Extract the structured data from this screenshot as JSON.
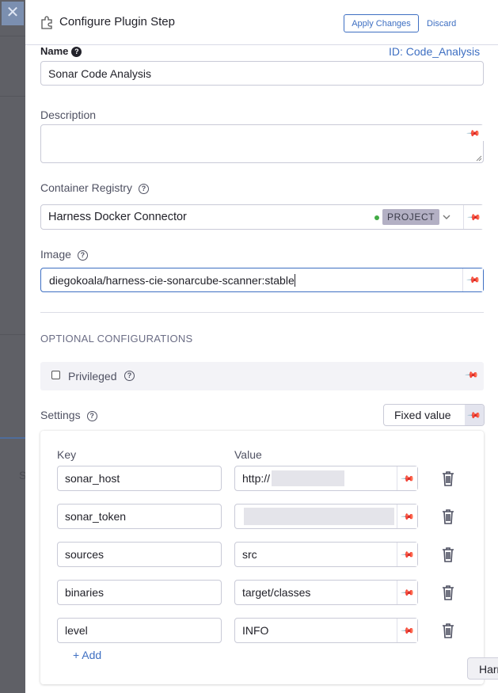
{
  "header": {
    "title": "Configure Plugin Step",
    "apply_label": "Apply Changes",
    "discard_label": "Discard"
  },
  "name_field": {
    "label": "Name",
    "value": "Sonar Code Analysis",
    "id_prefix": "ID: ",
    "id_value": "Code_Analysis"
  },
  "description": {
    "label": "Description",
    "value": ""
  },
  "registry": {
    "label": "Container Registry",
    "value": "Harness Docker Connector",
    "badge": "PROJECT",
    "status_color": "#42ab45"
  },
  "image": {
    "label": "Image",
    "value": "diegokoala/harness-cie-sonarcube-scanner:stable"
  },
  "optional": {
    "heading": "OPTIONAL CONFIGURATIONS",
    "privileged_label": "Privileged"
  },
  "settings": {
    "label": "Settings",
    "mode_label": "Fixed value",
    "key_header": "Key",
    "value_header": "Value",
    "rows": [
      {
        "key": "sonar_host",
        "value": "http://"
      },
      {
        "key": "sonar_token",
        "value": ""
      },
      {
        "key": "sources",
        "value": "src"
      },
      {
        "key": "binaries",
        "value": "target/classes"
      },
      {
        "key": "level",
        "value": "INFO"
      }
    ],
    "add_label": "+ Add"
  },
  "bg": {
    "close_glyph": "✕",
    "side_letter": "S"
  },
  "floating_tab": {
    "label": "Harness"
  },
  "colors": {
    "accent": "#3e6fc2",
    "badge_bg": "#b3b0c4"
  },
  "icons": [
    "close-icon",
    "plugin-icon",
    "help-icon",
    "pin-icon",
    "chevron-down-icon",
    "trash-icon"
  ]
}
